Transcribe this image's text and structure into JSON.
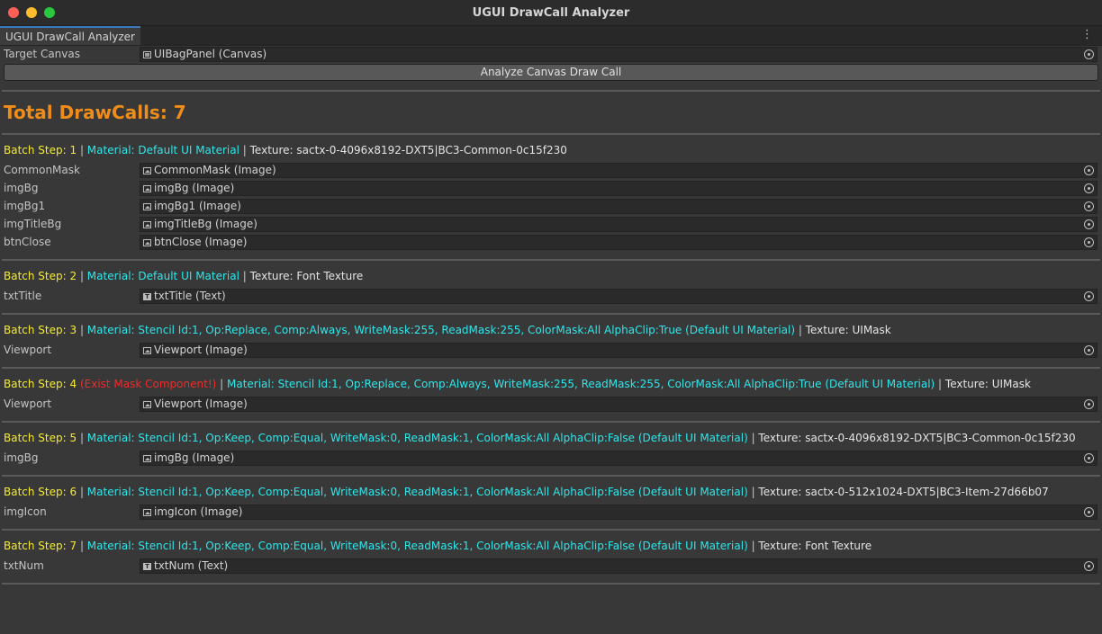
{
  "window": {
    "title": "UGUI DrawCall Analyzer"
  },
  "tab": {
    "label": "UGUI DrawCall Analyzer"
  },
  "target": {
    "label": "Target Canvas",
    "value": "UIBagPanel (Canvas)"
  },
  "analyze_button": "Analyze Canvas Draw Call",
  "total": "Total DrawCalls: 7",
  "batches": [
    {
      "step": "Batch Step: 1",
      "warning": "",
      "material": "Material: Default UI Material",
      "texture": "Texture: sactx-0-4096x8192-DXT5|BC3-Common-0c15f230",
      "items": [
        {
          "label": "CommonMask",
          "value": "CommonMask (Image)",
          "icon": "image-icon"
        },
        {
          "label": "imgBg",
          "value": "imgBg (Image)",
          "icon": "image-icon"
        },
        {
          "label": "imgBg1",
          "value": "imgBg1 (Image)",
          "icon": "image-icon"
        },
        {
          "label": "imgTitleBg",
          "value": "imgTitleBg (Image)",
          "icon": "image-icon"
        },
        {
          "label": "btnClose",
          "value": "btnClose (Image)",
          "icon": "image-icon"
        }
      ]
    },
    {
      "step": "Batch Step: 2",
      "warning": "",
      "material": "Material: Default UI Material",
      "texture": "Texture: Font Texture",
      "items": [
        {
          "label": "txtTitle",
          "value": "txtTitle (Text)",
          "icon": "text-icon"
        }
      ]
    },
    {
      "step": "Batch Step: 3",
      "warning": "",
      "material": "Material: Stencil Id:1, Op:Replace, Comp:Always, WriteMask:255, ReadMask:255, ColorMask:All AlphaClip:True (Default UI Material)",
      "texture": "Texture: UIMask",
      "items": [
        {
          "label": "Viewport",
          "value": "Viewport (Image)",
          "icon": "image-icon"
        }
      ]
    },
    {
      "step": "Batch Step: 4",
      "warning": "(Exist Mask Component!)",
      "material": "Material: Stencil Id:1, Op:Replace, Comp:Always, WriteMask:255, ReadMask:255, ColorMask:All AlphaClip:True (Default UI Material)",
      "texture": "Texture: UIMask",
      "items": [
        {
          "label": "Viewport",
          "value": "Viewport (Image)",
          "icon": "image-icon"
        }
      ]
    },
    {
      "step": "Batch Step: 5",
      "warning": "",
      "material": "Material: Stencil Id:1, Op:Keep, Comp:Equal, WriteMask:0, ReadMask:1, ColorMask:All AlphaClip:False (Default UI Material)",
      "texture": "Texture: sactx-0-4096x8192-DXT5|BC3-Common-0c15f230",
      "items": [
        {
          "label": "imgBg",
          "value": "imgBg (Image)",
          "icon": "image-icon"
        }
      ]
    },
    {
      "step": "Batch Step: 6",
      "warning": "",
      "material": "Material: Stencil Id:1, Op:Keep, Comp:Equal, WriteMask:0, ReadMask:1, ColorMask:All AlphaClip:False (Default UI Material)",
      "texture": "Texture: sactx-0-512x1024-DXT5|BC3-Item-27d66b07",
      "items": [
        {
          "label": "imgIcon",
          "value": "imgIcon (Image)",
          "icon": "image-icon"
        }
      ]
    },
    {
      "step": "Batch Step: 7",
      "warning": "",
      "material": "Material: Stencil Id:1, Op:Keep, Comp:Equal, WriteMask:0, ReadMask:1, ColorMask:All AlphaClip:False (Default UI Material)",
      "texture": "Texture: Font Texture",
      "items": [
        {
          "label": "txtNum",
          "value": "txtNum (Text)",
          "icon": "text-icon"
        }
      ]
    }
  ],
  "colors": {
    "step": "#f5ea2f",
    "warning": "#ee2b2b",
    "material": "#2ee6ea",
    "total": "#ef8c1a"
  }
}
